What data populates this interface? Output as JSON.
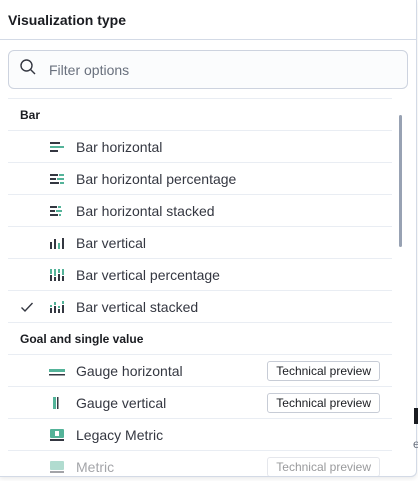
{
  "header": {
    "title": "Visualization type"
  },
  "search": {
    "placeholder": "Filter options"
  },
  "groups": [
    {
      "title": "Bar",
      "items": [
        {
          "label": "Bar horizontal",
          "icon": "bar-horizontal-icon",
          "selected": false
        },
        {
          "label": "Bar horizontal percentage",
          "icon": "bar-horizontal-percentage-icon",
          "selected": false
        },
        {
          "label": "Bar horizontal stacked",
          "icon": "bar-horizontal-stacked-icon",
          "selected": false
        },
        {
          "label": "Bar vertical",
          "icon": "bar-vertical-icon",
          "selected": false
        },
        {
          "label": "Bar vertical percentage",
          "icon": "bar-vertical-percentage-icon",
          "selected": false
        },
        {
          "label": "Bar vertical stacked",
          "icon": "bar-vertical-stacked-icon",
          "selected": true
        }
      ]
    },
    {
      "title": "Goal and single value",
      "items": [
        {
          "label": "Gauge horizontal",
          "icon": "gauge-horizontal-icon",
          "badge": "Technical preview"
        },
        {
          "label": "Gauge vertical",
          "icon": "gauge-vertical-icon",
          "badge": "Technical preview"
        },
        {
          "label": "Legacy Metric",
          "icon": "legacy-metric-icon"
        },
        {
          "label": "Metric",
          "icon": "metric-icon",
          "badge": "Technical preview"
        }
      ]
    }
  ],
  "edge_text": "e",
  "colors": {
    "accent_teal": "#54b399",
    "icon_dark": "#69707d",
    "check": "#343741"
  }
}
